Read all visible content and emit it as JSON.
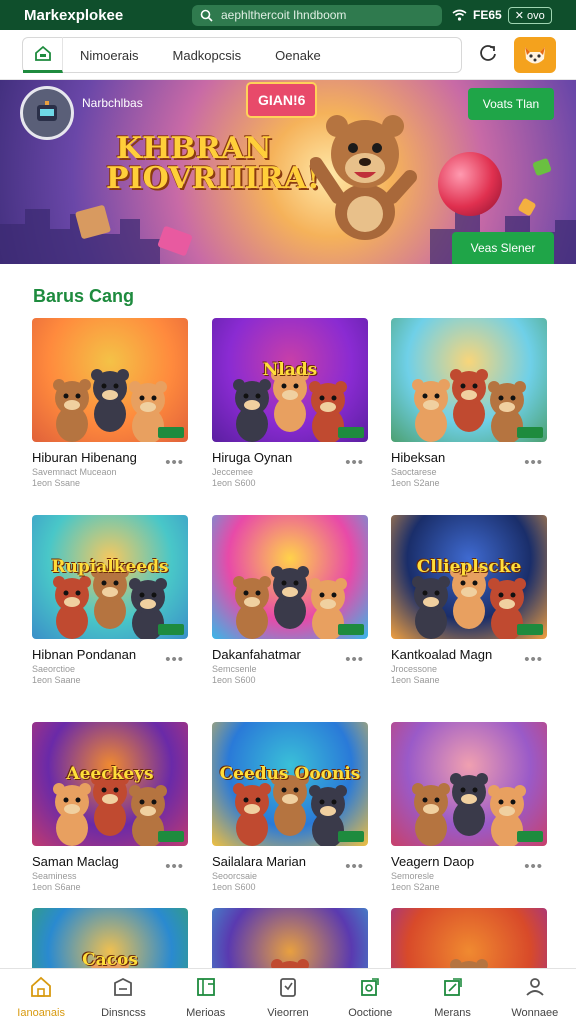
{
  "app": {
    "title": "Markexplokee"
  },
  "search": {
    "placeholder": "aephlthercoit Ihndboom"
  },
  "status": {
    "text": "FE65",
    "chip": "✕ ovo"
  },
  "nav": {
    "tabs": [
      "Nimoerais",
      "Madkopcsis",
      "Oenake"
    ]
  },
  "banner": {
    "user": "Narbchlbas",
    "badge": "GIAN!6",
    "headline_line1": "KHBRAN",
    "headline_line2": "PIOVRIIIRA!",
    "btn_top": "Voats Tlan",
    "btn_bottom": "Veas Slener"
  },
  "section": {
    "title": "Barus Cang"
  },
  "games": [
    {
      "name": "Hiburan Hibenang",
      "sub": "Savemnact Muceaon",
      "meta": "1eon  Ssane",
      "thumb_text": "",
      "colors": [
        "#ff8a3d",
        "#f4c247",
        "#e0613a"
      ]
    },
    {
      "name": "Hiruga Oynan",
      "sub": "Jeccemee",
      "meta": "1eon  S600",
      "thumb_text": "Nlads",
      "colors": [
        "#8a2bd2",
        "#c83fa8",
        "#5a1fa0"
      ]
    },
    {
      "name": "Hibeksan",
      "sub": "Saoctarese",
      "meta": "1eon  S2ane",
      "thumb_text": "",
      "colors": [
        "#6fd0e8",
        "#f8d57a",
        "#4ca070"
      ]
    },
    {
      "name": "Hibnan Pondanan",
      "sub": "Saeorctioe",
      "meta": "1eon  Saane",
      "thumb_text": "Rupialkeeds",
      "colors": [
        "#49c7c8",
        "#f6c85f",
        "#3a8fc8"
      ]
    },
    {
      "name": "Dakanfahatmar",
      "sub": "Semcsenle",
      "meta": "1eon  S600",
      "thumb_text": "",
      "colors": [
        "#e84aa8",
        "#ffd24a",
        "#38b7e8"
      ]
    },
    {
      "name": "Kantkoalad Magn",
      "sub": "Jrocessone",
      "meta": "1eon  Saane",
      "thumb_text": "Cllieplscke",
      "colors": [
        "#1a2e6a",
        "#3f6ad0",
        "#f0a040"
      ]
    },
    {
      "name": "Saman Maclag",
      "sub": "Seaminess",
      "meta": "1eon  S6ane",
      "thumb_text": "Aeeckeys",
      "colors": [
        "#6a2aa8",
        "#f08a30",
        "#c03a70"
      ]
    },
    {
      "name": "Sailalara Marian",
      "sub": "Seoorcsaie",
      "meta": "1eon  S600",
      "thumb_text": "Ceedus Ooonis",
      "colors": [
        "#2a7ad8",
        "#3ac0d8",
        "#f0c040"
      ]
    },
    {
      "name": "Veagern Daop",
      "sub": "Semoresle",
      "meta": "1eon  S2ane",
      "thumb_text": "",
      "colors": [
        "#9a5ac8",
        "#f0a0b0",
        "#c8406a"
      ]
    },
    {
      "name": "",
      "sub": "",
      "meta": "",
      "thumb_text": "Cacos",
      "colors": [
        "#2a8ad0",
        "#f0c050",
        "#38a858"
      ]
    },
    {
      "name": "",
      "sub": "",
      "meta": "",
      "thumb_text": "",
      "colors": [
        "#5a3ab0",
        "#e8a040",
        "#38b0d8"
      ]
    },
    {
      "name": "",
      "sub": "",
      "meta": "",
      "thumb_text": "",
      "colors": [
        "#d84a2a",
        "#f08a30",
        "#8a2ab0"
      ]
    }
  ],
  "bottom_nav": [
    {
      "label": "Ianoanais",
      "icon": "home-icon"
    },
    {
      "label": "Dinsncss",
      "icon": "discover-icon"
    },
    {
      "label": "Merioas",
      "icon": "library-icon"
    },
    {
      "label": "Vieorren",
      "icon": "reviews-icon"
    },
    {
      "label": "Ooctione",
      "icon": "collection-icon"
    },
    {
      "label": "Merans",
      "icon": "updates-icon"
    },
    {
      "label": "Wonnaee",
      "icon": "profile-icon"
    }
  ],
  "colors": {
    "accent": "#1e8b3e",
    "statusbar": "#0f4f2c",
    "active_nav": "#d89a10"
  }
}
